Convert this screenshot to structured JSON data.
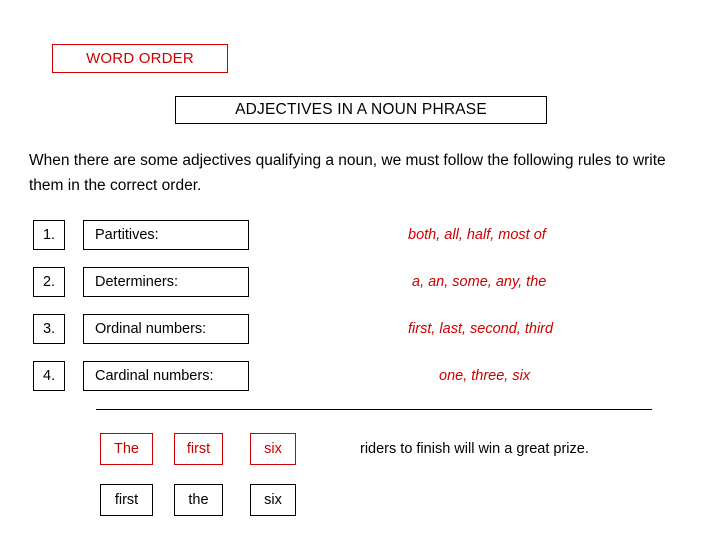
{
  "title_boxes": {
    "word_order": "WORD ORDER",
    "adjectives": "ADJECTIVES IN A NOUN PHRASE"
  },
  "intro": "When there are some adjectives qualifying a noun, we must follow the following rules to write them in the correct order.",
  "rules": [
    {
      "number": "1.",
      "label": "Partitives:",
      "examples": "both, all, half, most of"
    },
    {
      "number": "2.",
      "label": "Determiners:",
      "examples": "a, an, some, any, the"
    },
    {
      "number": "3.",
      "label": "Ordinal numbers:",
      "examples": "first, last, second, third"
    },
    {
      "number": "4.",
      "label": "Cardinal numbers:",
      "examples": "one, three, six"
    }
  ],
  "example": {
    "correct_row": {
      "word1": "The",
      "word2": "first",
      "word3": "six",
      "tail": "riders to finish will win a great prize."
    },
    "incorrect_row": {
      "word1": "first",
      "word2": "the",
      "word3": "six"
    }
  },
  "colors": {
    "accent_red": "#cc0000",
    "text_black": "#000000",
    "background": "#ffffff"
  }
}
